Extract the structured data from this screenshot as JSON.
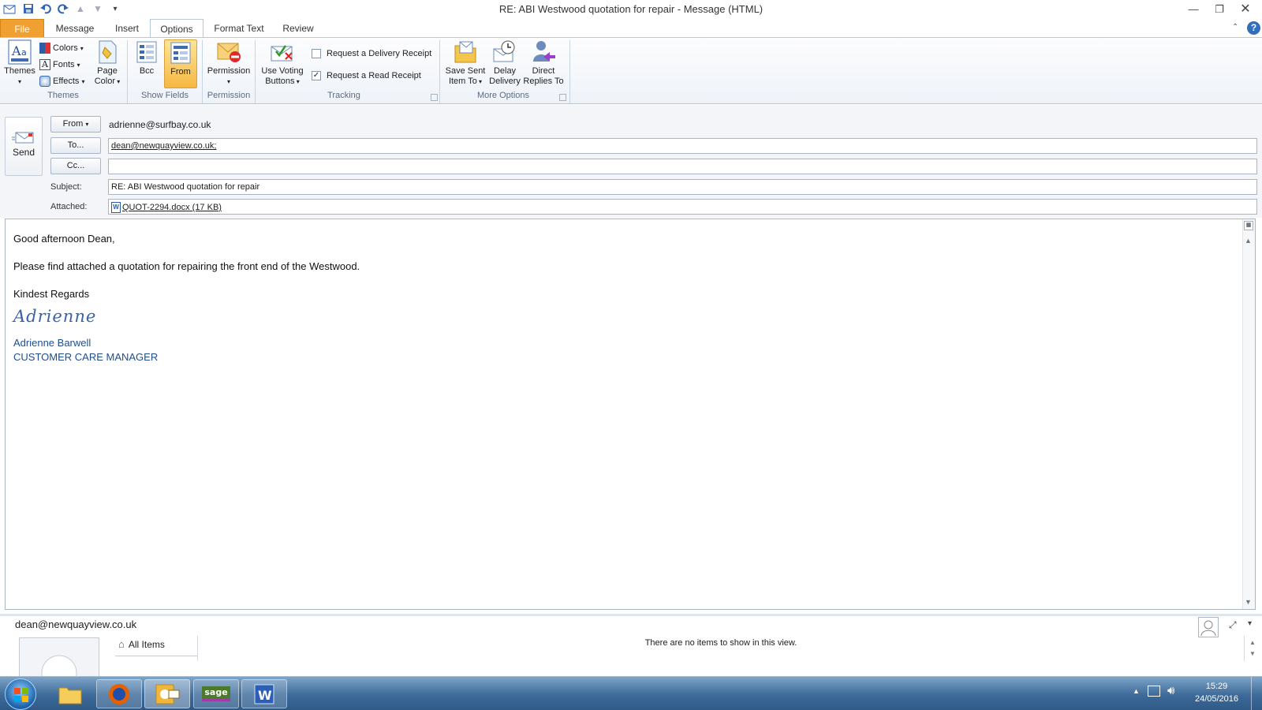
{
  "window": {
    "title": "RE: ABI Westwood quotation for repair  -  Message (HTML)"
  },
  "tabs": [
    "File",
    "Message",
    "Insert",
    "Options",
    "Format Text",
    "Review"
  ],
  "ribbon": {
    "themes": {
      "themes_label": "Themes",
      "colors_label": "Colors",
      "fonts_label": "Fonts",
      "effects_label": "Effects",
      "page_color_line1": "Page",
      "page_color_line2": "Color",
      "group_label": "Themes"
    },
    "show_fields": {
      "bcc_label": "Bcc",
      "from_label": "From",
      "group_label": "Show Fields"
    },
    "permission": {
      "permission_label": "Permission",
      "group_label": "Permission"
    },
    "tracking": {
      "voting_line1": "Use Voting",
      "voting_line2": "Buttons",
      "delivery_receipt_label": "Request a Delivery Receipt",
      "delivery_receipt_checked": false,
      "read_receipt_label": "Request a Read Receipt",
      "read_receipt_checked": true,
      "group_label": "Tracking"
    },
    "more_options": {
      "save_sent_line1": "Save Sent",
      "save_sent_line2": "Item To",
      "delay_line1": "Delay",
      "delay_line2": "Delivery",
      "direct_line1": "Direct",
      "direct_line2": "Replies To",
      "group_label": "More Options"
    }
  },
  "compose": {
    "send_label": "Send",
    "from_button": "From",
    "from_value": "adrienne@surfbay.co.uk",
    "to_button": "To...",
    "to_value": "dean@newquayview.co.uk;",
    "cc_button": "Cc...",
    "cc_value": "",
    "subject_label": "Subject:",
    "subject_value": "RE: ABI Westwood quotation for repair",
    "attached_label": "Attached:",
    "attachment": "QUOT-2294.docx (17 KB)"
  },
  "message_body": {
    "greeting": "Good afternoon Dean,",
    "line1": "Please find attached a quotation for repairing the front end of the Westwood.",
    "closing": "Kindest Regards",
    "signature_script": "Adrienne",
    "sig_name": "Adrienne Barwell",
    "sig_title": "CUSTOMER CARE MANAGER"
  },
  "people_pane": {
    "contact": "dean@newquayview.co.uk",
    "all_items": "All Items",
    "empty_message": "There are no items to show in this view."
  },
  "taskbar": {
    "time": "15:29",
    "date": "24/05/2016",
    "sage_label": "sage"
  }
}
